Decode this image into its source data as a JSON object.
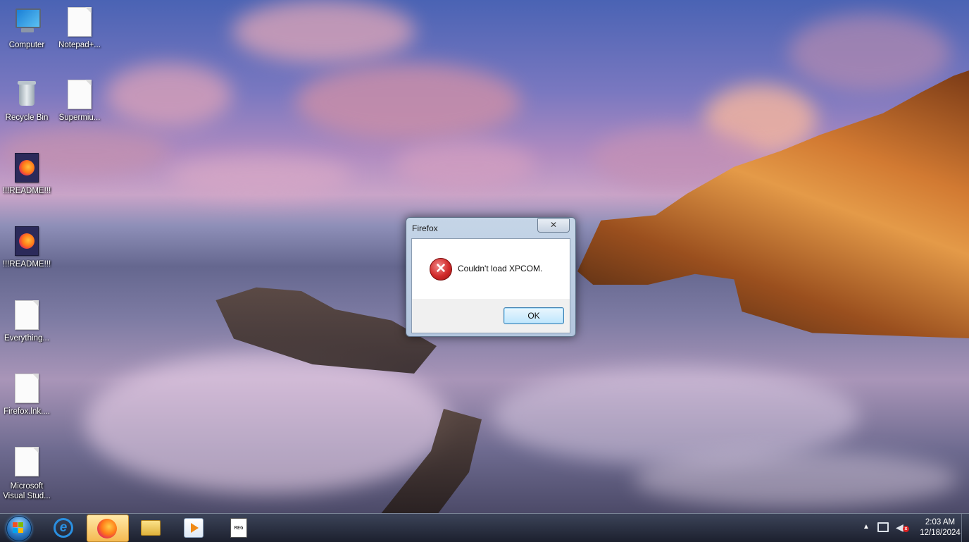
{
  "desktop": {
    "icons": [
      {
        "label": "Computer",
        "icon": "computer-icon"
      },
      {
        "label": "Notepad+...",
        "icon": "document-icon"
      },
      {
        "label": "Recycle Bin",
        "icon": "recycle-bin-icon"
      },
      {
        "label": "Supermiu...",
        "icon": "document-icon"
      },
      {
        "label": "!!!README!!!",
        "icon": "firefox-file-icon"
      },
      {
        "label": "!!!README!!!",
        "icon": "firefox-file-icon"
      },
      {
        "label": "Everything...",
        "icon": "document-icon"
      },
      {
        "label": "Firefox.lnk....",
        "icon": "document-icon"
      },
      {
        "label": "Microsoft",
        "label2": "Visual Stud...",
        "icon": "document-icon"
      }
    ]
  },
  "dialog": {
    "title": "Firefox",
    "close_glyph": "✕",
    "icon": "error-icon",
    "icon_glyph": "✕",
    "message": "Couldn't load XPCOM.",
    "ok_label": "OK"
  },
  "taskbar": {
    "apps": [
      {
        "name": "internet-explorer",
        "icon": "ie-icon",
        "glyph": "e",
        "active": false
      },
      {
        "name": "firefox",
        "icon": "firefox-icon",
        "active": true
      },
      {
        "name": "file-explorer",
        "icon": "folder-icon",
        "active": false
      },
      {
        "name": "media-player",
        "icon": "media-player-icon",
        "active": false
      },
      {
        "name": "registry-file",
        "icon": "registry-file-icon",
        "glyph": "REG",
        "active": false
      }
    ],
    "tray": {
      "overflow_glyph": "▲",
      "volume_glyph": "◀",
      "mute_glyph": "x",
      "time": "2:03 AM",
      "date": "12/18/2024"
    }
  },
  "colors": {
    "taskbar_active": "#f4b951",
    "error_red": "#d12a2a",
    "ok_button_border": "#3c7fb1"
  }
}
